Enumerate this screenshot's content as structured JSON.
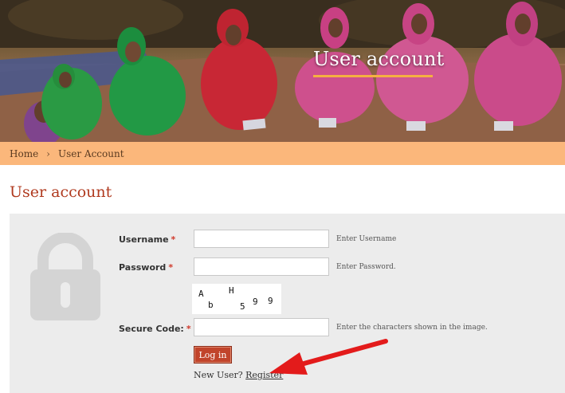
{
  "banner": {
    "title": "User account"
  },
  "breadcrumb": {
    "home": "Home",
    "separator": "›",
    "current": "User Account"
  },
  "page": {
    "title": "User account"
  },
  "form": {
    "username": {
      "label": "Username",
      "required_mark": "*",
      "value": "",
      "hint": "Enter Username"
    },
    "password": {
      "label": "Password",
      "required_mark": "*",
      "value": "",
      "hint": "Enter Password."
    },
    "captcha": {
      "chars": [
        "A",
        "H",
        "b",
        "5",
        "9",
        "9"
      ]
    },
    "secure_code": {
      "label": "Secure Code:",
      "required_mark": "*",
      "value": "",
      "hint": "Enter the characters shown in the image."
    },
    "login_button": "Log in",
    "new_user_text": "New User?",
    "register_link": "Register"
  },
  "colors": {
    "accent": "#c1442b",
    "breadcrumb_bg": "#fbb77b",
    "title": "#b03a1f",
    "panel_bg": "#ececec",
    "annotation_arrow": "#e31b1b"
  },
  "icons": {
    "lock": "lock-icon",
    "arrow": "annotation-arrow"
  }
}
